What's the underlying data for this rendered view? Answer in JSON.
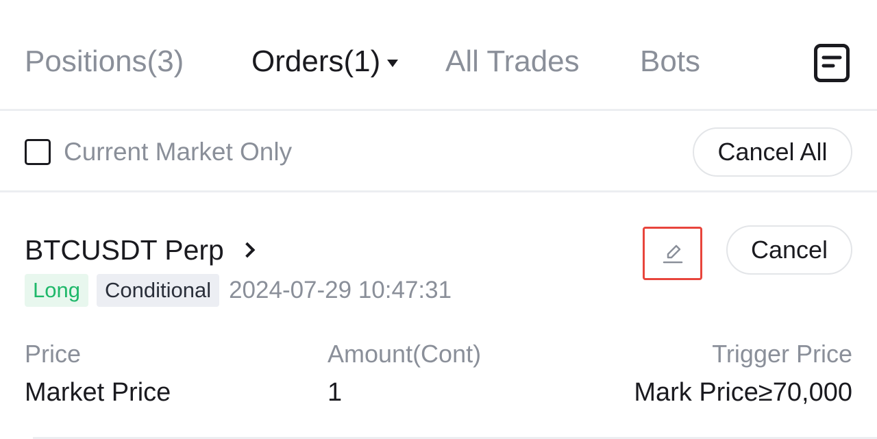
{
  "tabs": [
    {
      "label": "Positions(3)",
      "active": false
    },
    {
      "label": "Orders(1)",
      "active": true
    },
    {
      "label": "All Trades",
      "active": false
    },
    {
      "label": "Bots",
      "active": false
    }
  ],
  "header": {
    "doc_icon": "document-icon"
  },
  "filter": {
    "checkbox_checked": false,
    "label": "Current Market Only",
    "cancel_all_label": "Cancel All"
  },
  "order": {
    "symbol": "BTCUSDT Perp",
    "edit_icon": "pencil-icon",
    "cancel_label": "Cancel",
    "side_tag": "Long",
    "type_tag": "Conditional",
    "timestamp": "2024-07-29 10:47:31",
    "fields": [
      {
        "label": "Price",
        "value": "Market Price"
      },
      {
        "label": "Amount(Cont)",
        "value": "1"
      },
      {
        "label": "Trigger Price",
        "value": "Mark Price≥70,000"
      }
    ]
  },
  "colors": {
    "accent_green": "#1fb86a",
    "highlight_red": "#e8453c",
    "muted_text": "#8a8f99"
  }
}
